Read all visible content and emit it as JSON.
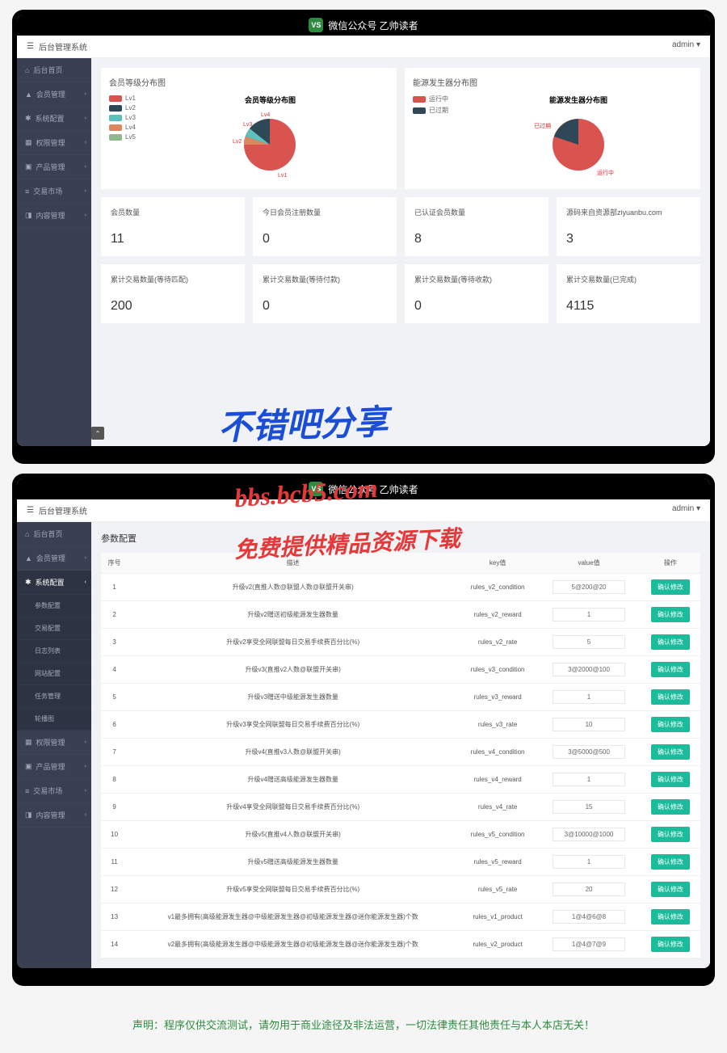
{
  "topbar": {
    "logo": "VS",
    "title": "微信公众号  乙帅读者"
  },
  "header": {
    "system_name": "后台管理系统",
    "user": "admin"
  },
  "sidebar1": [
    {
      "icon": "⌂",
      "label": "后台首页",
      "active": false
    },
    {
      "icon": "▲",
      "label": "会员管理",
      "arrow": "›"
    },
    {
      "icon": "✱",
      "label": "系统配置",
      "arrow": "›"
    },
    {
      "icon": "▦",
      "label": "权限管理",
      "arrow": "›"
    },
    {
      "icon": "▣",
      "label": "产品管理",
      "arrow": "›"
    },
    {
      "icon": "≡",
      "label": "交易市场",
      "arrow": "›"
    },
    {
      "icon": "◨",
      "label": "内容管理",
      "arrow": "›"
    }
  ],
  "sidebar2": {
    "items": [
      {
        "icon": "⌂",
        "label": "后台首页"
      },
      {
        "icon": "▲",
        "label": "会员管理",
        "arrow": "›"
      },
      {
        "icon": "✱",
        "label": "系统配置",
        "arrow": "‹",
        "active": true
      }
    ],
    "subs": [
      "参数配置",
      "交易配置",
      "日志列表",
      "网站配置",
      "任务管理",
      "轮播图"
    ],
    "rest": [
      {
        "icon": "▦",
        "label": "权限管理",
        "arrow": "›"
      },
      {
        "icon": "▣",
        "label": "产品管理",
        "arrow": "›"
      },
      {
        "icon": "≡",
        "label": "交易市场",
        "arrow": "›"
      },
      {
        "icon": "◨",
        "label": "内容管理",
        "arrow": "›"
      }
    ]
  },
  "chart1": {
    "card_title": "会员等级分布图",
    "pie_title": "会员等级分布图",
    "legend": [
      {
        "label": "Lv1",
        "color": "#d9534f"
      },
      {
        "label": "Lv2",
        "color": "#2f4858"
      },
      {
        "label": "Lv3",
        "color": "#5bc0be"
      },
      {
        "label": "Lv4",
        "color": "#d9885f"
      },
      {
        "label": "Lv5",
        "color": "#8fb88f"
      }
    ]
  },
  "chart2": {
    "card_title": "能源发生器分布图",
    "pie_title": "能源发生器分布图",
    "legend": [
      {
        "label": "运行中",
        "color": "#d9534f"
      },
      {
        "label": "已过期",
        "color": "#2f4858"
      }
    ],
    "label_running": "运行中",
    "label_expired": "已过期"
  },
  "chart_data": [
    {
      "type": "pie",
      "title": "会员等级分布图",
      "series": [
        {
          "name": "Lv1",
          "value": 78
        },
        {
          "name": "Lv2",
          "value": 10
        },
        {
          "name": "Lv3",
          "value": 7
        },
        {
          "name": "Lv4",
          "value": 3
        },
        {
          "name": "Lv5",
          "value": 2
        }
      ]
    },
    {
      "type": "pie",
      "title": "能源发生器分布图",
      "series": [
        {
          "name": "运行中",
          "value": 80
        },
        {
          "name": "已过期",
          "value": 20
        }
      ]
    }
  ],
  "stats1": [
    {
      "label": "会员数量",
      "value": "11"
    },
    {
      "label": "今日会员注册数量",
      "value": "0"
    },
    {
      "label": "已认证会员数量",
      "value": "8"
    },
    {
      "label": "源码来自资源部ziyuanbu.com",
      "value": "3"
    }
  ],
  "stats2": [
    {
      "label": "累计交易数量(等待匹配)",
      "value": "200"
    },
    {
      "label": "累计交易数量(等待付款)",
      "value": "0"
    },
    {
      "label": "累计交易数量(等待收款)",
      "value": "0"
    },
    {
      "label": "累计交易数量(已完成)",
      "value": "4115"
    }
  ],
  "params": {
    "heading": "参数配置",
    "columns": [
      "序号",
      "描述",
      "key值",
      "value值",
      "操作"
    ],
    "btn": "确认修改",
    "rows": [
      {
        "no": "1",
        "desc": "升级v2(直推人数@联盟人数@联盟开关串)",
        "key": "rules_v2_condition",
        "val": "5@200@20"
      },
      {
        "no": "2",
        "desc": "升级v2赠送初级能源发生器数量",
        "key": "rules_v2_reward",
        "val": "1"
      },
      {
        "no": "3",
        "desc": "升级v2享受全网联盟每日交易手续费百分比(%)",
        "key": "rules_v2_rate",
        "val": "5"
      },
      {
        "no": "4",
        "desc": "升级v3(直推v2人数@联盟开关串)",
        "key": "rules_v3_condition",
        "val": "3@2000@100"
      },
      {
        "no": "5",
        "desc": "升级v3赠送中级能源发生器数量",
        "key": "rules_v3_reward",
        "val": "1"
      },
      {
        "no": "6",
        "desc": "升级v3享受全网联盟每日交易手续费百分比(%)",
        "key": "rules_v3_rate",
        "val": "10"
      },
      {
        "no": "7",
        "desc": "升级v4(直推v3人数@联盟开关串)",
        "key": "rules_v4_condition",
        "val": "3@5000@500"
      },
      {
        "no": "8",
        "desc": "升级v4赠送高级能源发生器数量",
        "key": "rules_v4_reward",
        "val": "1"
      },
      {
        "no": "9",
        "desc": "升级v4享受全网联盟每日交易手续费百分比(%)",
        "key": "rules_v4_rate",
        "val": "15"
      },
      {
        "no": "10",
        "desc": "升级v5(直推v4人数@联盟开关串)",
        "key": "rules_v5_condition",
        "val": "3@10000@1000"
      },
      {
        "no": "11",
        "desc": "升级v5赠送高级能源发生器数量",
        "key": "rules_v5_reward",
        "val": "1"
      },
      {
        "no": "12",
        "desc": "升级v5享受全网联盟每日交易手续费百分比(%)",
        "key": "rules_v5_rate",
        "val": "20"
      },
      {
        "no": "13",
        "desc": "v1最多拥有(高级能源发生器@中级能源发生器@初级能源发生器@迷你能源发生器)个数",
        "key": "rules_v1_product",
        "val": "1@4@6@8"
      },
      {
        "no": "14",
        "desc": "v2最多拥有(高级能源发生器@中级能源发生器@初级能源发生器@迷你能源发生器)个数",
        "key": "rules_v2_product",
        "val": "1@4@7@9"
      }
    ]
  },
  "watermarks": {
    "w1": "不错吧分享",
    "w2": "bbs.bcb5.com",
    "w3": "免费提供精品资源下载"
  },
  "disclaimer": "声明：程序仅供交流测试，请勿用于商业途径及非法运营，一切法律责任其他责任与本人本店无关！"
}
